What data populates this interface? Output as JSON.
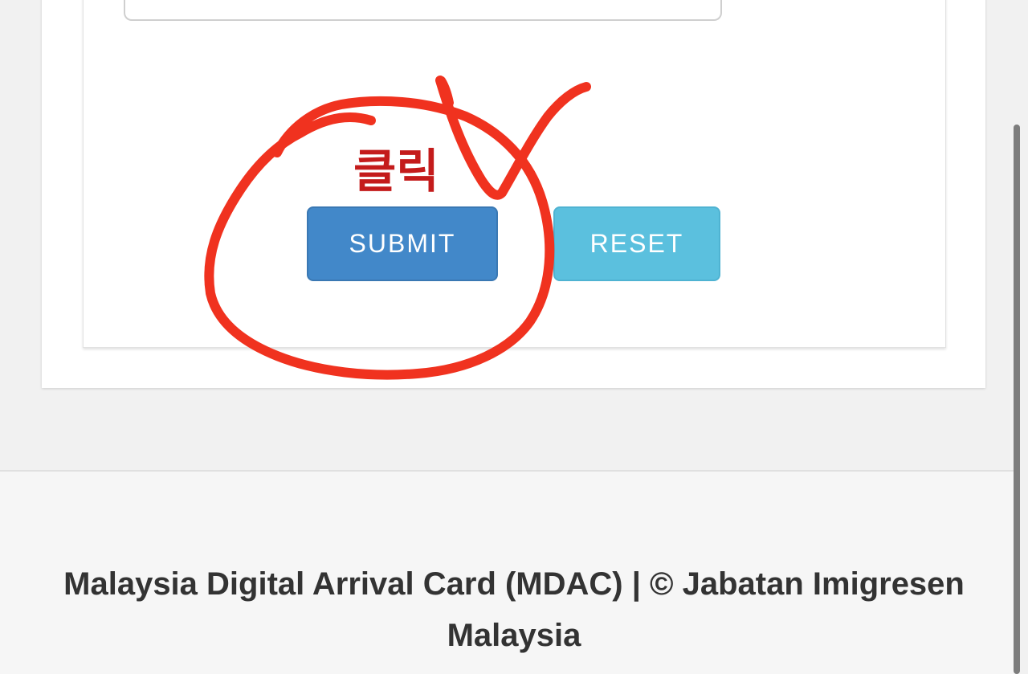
{
  "form": {
    "submit_label": "SUBMIT",
    "reset_label": "RESET"
  },
  "annotation": {
    "text": "클릭",
    "color": "#c41b1b",
    "stroke_color": "#f0321f"
  },
  "footer": {
    "text": "Malaysia Digital Arrival Card (MDAC) | © Jabatan Imigresen Malaysia"
  },
  "colors": {
    "submit_bg": "#4288c9",
    "reset_bg": "#5bc0de"
  }
}
